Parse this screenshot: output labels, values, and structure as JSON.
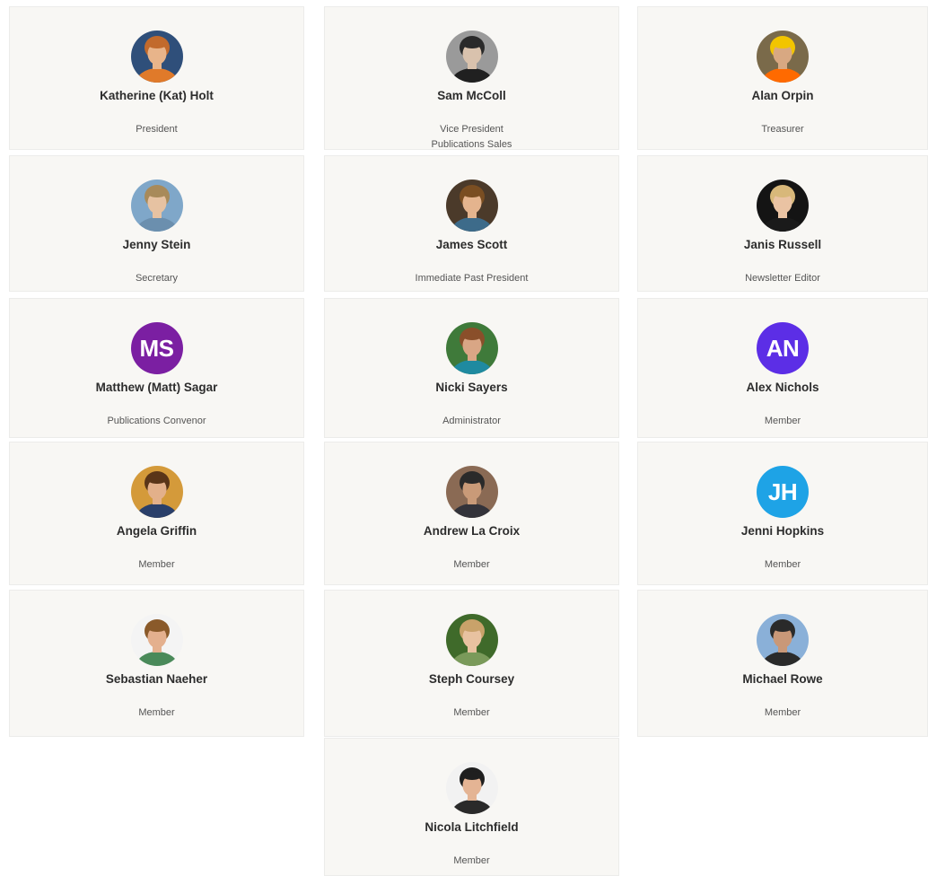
{
  "members": [
    {
      "name": "Katherine (Kat) Holt",
      "roles": [
        "President"
      ],
      "avatar": {
        "type": "photo",
        "icon": "person-photo-icon",
        "bg": "#2f4f7a",
        "hair": "#c26a2c",
        "skin": "#e8b48a",
        "shirt": "#e07a2a"
      }
    },
    {
      "name": "Sam McColl",
      "roles": [
        "Vice President",
        "Publications Sales"
      ],
      "avatar": {
        "type": "photo",
        "icon": "person-photo-icon",
        "bg": "#9a9a9a",
        "hair": "#2a2a2a",
        "skin": "#d9c2ad",
        "shirt": "#202020"
      }
    },
    {
      "name": "Alan Orpin",
      "roles": [
        "Treasurer"
      ],
      "avatar": {
        "type": "photo",
        "icon": "person-photo-icon",
        "bg": "#7a6a4a",
        "hair": "#f2c500",
        "skin": "#d8a882",
        "shirt": "#ff6a00"
      }
    },
    {
      "name": "Jenny Stein",
      "roles": [
        "Secretary"
      ],
      "avatar": {
        "type": "photo",
        "icon": "person-photo-icon",
        "bg": "#7fa7c9",
        "hair": "#a88a5a",
        "skin": "#e6c2a2",
        "shirt": "#6b8fae"
      }
    },
    {
      "name": "James Scott",
      "roles": [
        "Immediate Past President"
      ],
      "avatar": {
        "type": "photo",
        "icon": "person-photo-icon",
        "bg": "#4b3a2a",
        "hair": "#7a4e22",
        "skin": "#e4b48e",
        "shirt": "#3d6b8a"
      }
    },
    {
      "name": "Janis Russell",
      "roles": [
        "Newsletter Editor"
      ],
      "avatar": {
        "type": "photo",
        "icon": "person-photo-icon",
        "bg": "#141414",
        "hair": "#d8b87a",
        "skin": "#eac3a3",
        "shirt": "#1a1a1a"
      }
    },
    {
      "name": "Matthew (Matt) Sagar",
      "roles": [
        "Publications Convenor"
      ],
      "avatar": {
        "type": "initials",
        "icon": "initials-avatar-icon",
        "initials": "MS",
        "bg": "#7b1fa2"
      }
    },
    {
      "name": "Nicki Sayers",
      "roles": [
        "Administrator"
      ],
      "avatar": {
        "type": "photo",
        "icon": "person-photo-icon",
        "bg": "#3f7a3a",
        "hair": "#8a4f2a",
        "skin": "#d9a685",
        "shirt": "#1f8aa0"
      }
    },
    {
      "name": "Alex Nichols",
      "roles": [
        "Member"
      ],
      "avatar": {
        "type": "initials",
        "icon": "initials-avatar-icon",
        "initials": "AN",
        "bg": "#5c2ee6"
      }
    },
    {
      "name": "Angela Griffin",
      "roles": [
        "Member"
      ],
      "avatar": {
        "type": "photo",
        "icon": "person-photo-icon",
        "bg": "#d49a3a",
        "hair": "#5a3518",
        "skin": "#e3b08a",
        "shirt": "#2a3f6a"
      }
    },
    {
      "name": "Andrew La Croix",
      "roles": [
        "Member"
      ],
      "avatar": {
        "type": "photo",
        "icon": "person-photo-icon",
        "bg": "#8a6a54",
        "hair": "#2a2a2a",
        "skin": "#c99a78",
        "shirt": "#33333a"
      }
    },
    {
      "name": "Jenni Hopkins",
      "roles": [
        "Member"
      ],
      "avatar": {
        "type": "initials",
        "icon": "initials-avatar-icon",
        "initials": "JH",
        "bg": "#1ea3e6"
      }
    },
    {
      "name": "Sebastian Naeher",
      "roles": [
        "Member"
      ],
      "avatar": {
        "type": "photo",
        "icon": "person-photo-icon",
        "bg": "#f4f4f4",
        "hair": "#8a5a2a",
        "skin": "#e4b08e",
        "shirt": "#4a8a5a"
      }
    },
    {
      "name": "Steph Coursey",
      "roles": [
        "Member"
      ],
      "avatar": {
        "type": "photo",
        "icon": "person-photo-icon",
        "bg": "#3f6a2a",
        "hair": "#c9a26a",
        "skin": "#e8c2a0",
        "shirt": "#7a9a5a"
      }
    },
    {
      "name": "Michael Rowe",
      "roles": [
        "Member"
      ],
      "avatar": {
        "type": "photo",
        "icon": "person-photo-icon",
        "bg": "#8ab0d8",
        "hair": "#2a2a2a",
        "skin": "#c99878",
        "shirt": "#2a2a2a"
      }
    },
    {
      "name": "Nicola Litchfield",
      "roles": [
        "Member"
      ],
      "avatar": {
        "type": "photo",
        "icon": "person-photo-icon",
        "bg": "#f2f2f2",
        "hair": "#1f1f1f",
        "skin": "#e4b494",
        "shirt": "#2a2a2a"
      }
    }
  ]
}
